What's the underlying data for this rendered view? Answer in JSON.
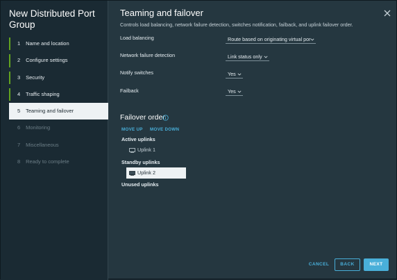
{
  "wizard": {
    "title": "New Distributed Port Group",
    "steps": [
      {
        "num": "1",
        "label": "Name and location",
        "state": "done"
      },
      {
        "num": "2",
        "label": "Configure settings",
        "state": "done"
      },
      {
        "num": "3",
        "label": "Security",
        "state": "done"
      },
      {
        "num": "4",
        "label": "Traffic shaping",
        "state": "done"
      },
      {
        "num": "5",
        "label": "Teaming and failover",
        "state": "active"
      },
      {
        "num": "6",
        "label": "Monitoring",
        "state": "disabled"
      },
      {
        "num": "7",
        "label": "Miscellaneous",
        "state": "disabled"
      },
      {
        "num": "8",
        "label": "Ready to complete",
        "state": "disabled"
      }
    ]
  },
  "page": {
    "title": "Teaming and failover",
    "subtitle": "Controls load balancing, network failure detection, switches notification, failback, and uplink failover order."
  },
  "fields": {
    "load_balancing": {
      "label": "Load balancing",
      "value": "Route based on originating virtual por"
    },
    "failure_detection": {
      "label": "Network failure detection",
      "value": "Link status only"
    },
    "notify_switches": {
      "label": "Notify switches",
      "value": "Yes"
    },
    "failback": {
      "label": "Failback",
      "value": "Yes"
    }
  },
  "failover": {
    "title": "Failover order",
    "move_up": "MOVE UP",
    "move_down": "MOVE DOWN",
    "active_label": "Active uplinks",
    "active_items": [
      "Uplink 1"
    ],
    "standby_label": "Standby uplinks",
    "standby_items": [
      "Uplink 2"
    ],
    "unused_label": "Unused uplinks"
  },
  "footer": {
    "cancel": "CANCEL",
    "back": "BACK",
    "next": "NEXT"
  },
  "icons": {
    "close": "close-icon",
    "info": "info-icon",
    "chevron": "chevron-down-icon",
    "uplink": "network-adapter-icon"
  },
  "colors": {
    "accent": "#49afd9",
    "done_marker": "#62a420"
  }
}
